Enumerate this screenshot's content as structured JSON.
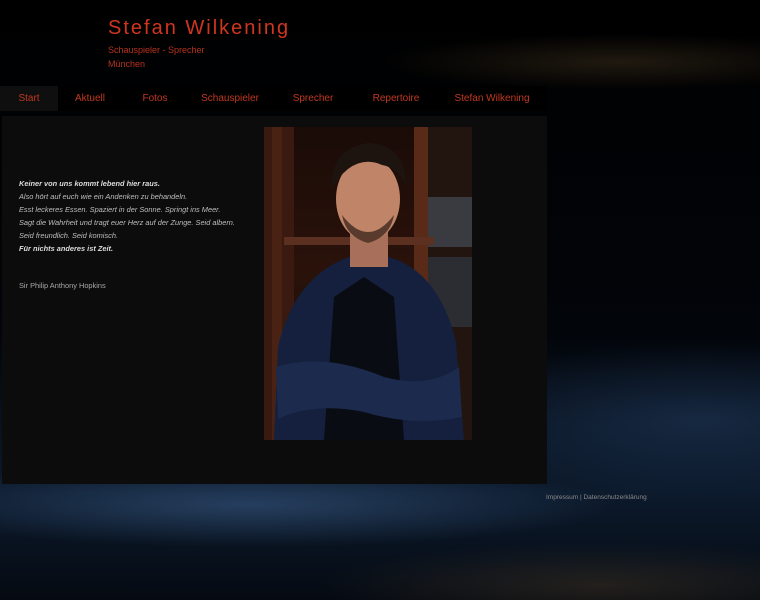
{
  "header": {
    "title": "Stefan Wilkening",
    "subtitle": "Schauspieler - Sprecher",
    "city": "München"
  },
  "nav": {
    "items": [
      {
        "label": "Start",
        "active": true
      },
      {
        "label": "Aktuell"
      },
      {
        "label": "Fotos"
      },
      {
        "label": "Schauspieler"
      },
      {
        "label": "Sprecher"
      },
      {
        "label": "Repertoire"
      },
      {
        "label": "Stefan Wilkening"
      }
    ]
  },
  "quote": {
    "lines": [
      "Keiner von uns kommt lebend hier raus.",
      "Also hört auf euch wie ein Andenken zu behandeln.",
      "Esst leckeres Essen. Spaziert in der Sonne. Springt ins Meer.",
      "Sagt die Wahrheit und tragt euer Herz auf der Zunge. Seid albern.",
      "Seid freundlich. Seid komisch.",
      "Für nichts anderes ist Zeit."
    ],
    "author": "Sir Philip Anthony Hopkins"
  },
  "footer": {
    "impressum": "Impressum",
    "separator": "|",
    "datenschutz": "Datenschutzerklärung"
  },
  "colors": {
    "accent": "#c23820",
    "background": "#000000",
    "panel": "#0c0c0c"
  }
}
